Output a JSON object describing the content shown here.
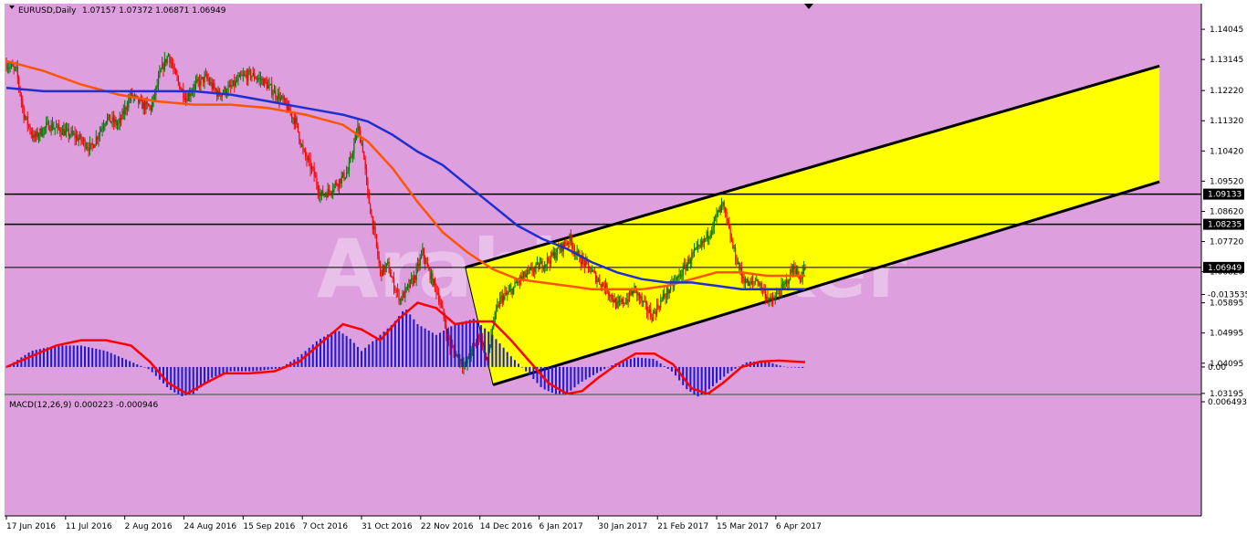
{
  "header": {
    "symbol_timeframe": "EURUSD,Daily",
    "ohlc": "1.07157 1.07372 1.06871 1.06949"
  },
  "macd_label": "MACD(12,26,9) 0.000223 -0.000946",
  "watermark": "ArabicBroker",
  "colors": {
    "background": "#dd9fdd",
    "channel_fill": "#ffff00",
    "bull_candle": "#007a00",
    "bear_candle": "#ff0000",
    "ma_fast": "#ff5500",
    "ma_slow": "#1f2fd0",
    "macd_hist": "#1a1ad8",
    "macd_signal": "#ff0000",
    "hlines": "#000000"
  },
  "chart_data": [
    {
      "type": "candlestick",
      "symbol": "EURUSD",
      "timeframe": "Daily",
      "ylim": [
        1.03,
        1.147
      ],
      "y_ticks": [
        "1.14045",
        "1.13145",
        "1.12220",
        "1.11320",
        "1.10420",
        "1.09520",
        "1.08620",
        "1.07720",
        "1.06820",
        "1.05895",
        "1.04995",
        "1.04095",
        "1.03195"
      ],
      "x_ticks": [
        "17 Jun 2016",
        "11 Jul 2016",
        "2 Aug 2016",
        "24 Aug 2016",
        "15 Sep 2016",
        "7 Oct 2016",
        "31 Oct 2016",
        "22 Nov 2016",
        "14 Dec 2016",
        "6 Jan 2017",
        "30 Jan 2017",
        "21 Feb 2017",
        "15 Mar 2017",
        "6 Apr 2017"
      ],
      "horizontal_levels": [
        {
          "label": "1.09133",
          "value": 1.09133
        },
        {
          "label": "1.08235",
          "value": 1.08235
        },
        {
          "label": "1.06949",
          "value": 1.06949
        }
      ],
      "trend_channel": {
        "upper": [
          [
            0.385,
            1.0695
          ],
          [
            0.965,
            1.1295
          ]
        ],
        "lower": [
          [
            0.4082,
            1.0345
          ],
          [
            0.965,
            1.095
          ]
        ]
      },
      "close_path": [
        [
          0,
          1.13
        ],
        [
          8,
          1.128
        ],
        [
          14,
          1.115
        ],
        [
          22,
          1.108
        ],
        [
          34,
          1.112
        ],
        [
          46,
          1.11
        ],
        [
          58,
          1.108
        ],
        [
          68,
          1.105
        ],
        [
          80,
          1.114
        ],
        [
          90,
          1.112
        ],
        [
          100,
          1.121
        ],
        [
          108,
          1.118
        ],
        [
          116,
          1.117
        ],
        [
          124,
          1.128
        ],
        [
          130,
          1.133
        ],
        [
          136,
          1.126
        ],
        [
          144,
          1.12
        ],
        [
          152,
          1.124
        ],
        [
          160,
          1.126
        ],
        [
          170,
          1.121
        ],
        [
          180,
          1.123
        ],
        [
          188,
          1.126
        ],
        [
          196,
          1.127
        ],
        [
          206,
          1.125
        ],
        [
          214,
          1.122
        ],
        [
          222,
          1.119
        ],
        [
          232,
          1.113
        ],
        [
          238,
          1.104
        ],
        [
          246,
          1.098
        ],
        [
          252,
          1.091
        ],
        [
          258,
          1.092
        ],
        [
          266,
          1.095
        ],
        [
          274,
          1.098
        ],
        [
          282,
          1.111
        ],
        [
          286,
          1.105
        ],
        [
          290,
          1.091
        ],
        [
          296,
          1.078
        ],
        [
          300,
          1.068
        ],
        [
          306,
          1.07
        ],
        [
          310,
          1.065
        ],
        [
          316,
          1.06
        ],
        [
          320,
          1.062
        ],
        [
          328,
          1.067
        ],
        [
          334,
          1.074
        ],
        [
          338,
          1.069
        ],
        [
          346,
          1.062
        ],
        [
          350,
          1.056
        ],
        [
          356,
          1.046
        ],
        [
          362,
          1.043
        ],
        [
          368,
          1.04
        ],
        [
          374,
          1.045
        ],
        [
          380,
          1.05
        ],
        [
          386,
          1.041
        ],
        [
          390,
          1.052
        ],
        [
          396,
          1.06
        ],
        [
          404,
          1.062
        ],
        [
          412,
          1.066
        ],
        [
          420,
          1.068
        ],
        [
          428,
          1.07
        ],
        [
          436,
          1.072
        ],
        [
          444,
          1.075
        ],
        [
          452,
          1.078
        ],
        [
          458,
          1.073
        ],
        [
          466,
          1.07
        ],
        [
          474,
          1.066
        ],
        [
          482,
          1.063
        ],
        [
          490,
          1.058
        ],
        [
          498,
          1.06
        ],
        [
          504,
          1.063
        ],
        [
          512,
          1.058
        ],
        [
          518,
          1.055
        ],
        [
          526,
          1.06
        ],
        [
          534,
          1.064
        ],
        [
          542,
          1.068
        ],
        [
          550,
          1.073
        ],
        [
          556,
          1.075
        ],
        [
          564,
          1.08
        ],
        [
          570,
          1.085
        ],
        [
          575,
          1.088
        ],
        [
          580,
          1.08
        ],
        [
          584,
          1.074
        ],
        [
          590,
          1.067
        ],
        [
          596,
          1.064
        ],
        [
          602,
          1.066
        ],
        [
          608,
          1.062
        ],
        [
          614,
          1.059
        ],
        [
          620,
          1.062
        ],
        [
          626,
          1.065
        ],
        [
          632,
          1.07
        ],
        [
          636,
          1.066
        ],
        [
          641,
          1.06949
        ]
      ],
      "series": [
        {
          "name": "",
          "type": "moving_average",
          "color": "#ff5500",
          "values": [
            [
              0,
              1.131
            ],
            [
              30,
              1.128
            ],
            [
              60,
              1.124
            ],
            [
              90,
              1.121
            ],
            [
              120,
              1.119
            ],
            [
              150,
              1.118
            ],
            [
              180,
              1.118
            ],
            [
              210,
              1.117
            ],
            [
              240,
              1.115
            ],
            [
              270,
              1.112
            ],
            [
              290,
              1.107
            ],
            [
              310,
              1.099
            ],
            [
              330,
              1.089
            ],
            [
              350,
              1.08
            ],
            [
              370,
              1.074
            ],
            [
              390,
              1.069
            ],
            [
              410,
              1.066
            ],
            [
              430,
              1.065
            ],
            [
              450,
              1.064
            ],
            [
              470,
              1.063
            ],
            [
              490,
              1.063
            ],
            [
              510,
              1.063
            ],
            [
              530,
              1.064
            ],
            [
              550,
              1.066
            ],
            [
              570,
              1.068
            ],
            [
              590,
              1.068
            ],
            [
              610,
              1.067
            ],
            [
              630,
              1.067
            ],
            [
              641,
              1.067
            ]
          ]
        },
        {
          "name": "",
          "type": "moving_average",
          "color": "#1f2fd0",
          "values": [
            [
              0,
              1.123
            ],
            [
              30,
              1.122
            ],
            [
              60,
              1.122
            ],
            [
              90,
              1.122
            ],
            [
              120,
              1.122
            ],
            [
              150,
              1.122
            ],
            [
              180,
              1.121
            ],
            [
              210,
              1.119
            ],
            [
              240,
              1.117
            ],
            [
              270,
              1.115
            ],
            [
              290,
              1.113
            ],
            [
              310,
              1.109
            ],
            [
              330,
              1.104
            ],
            [
              350,
              1.1
            ],
            [
              370,
              1.094
            ],
            [
              390,
              1.088
            ],
            [
              410,
              1.082
            ],
            [
              430,
              1.078
            ],
            [
              450,
              1.075
            ],
            [
              470,
              1.071
            ],
            [
              490,
              1.068
            ],
            [
              510,
              1.066
            ],
            [
              530,
              1.065
            ],
            [
              550,
              1.065
            ],
            [
              570,
              1.064
            ],
            [
              590,
              1.063
            ],
            [
              610,
              1.063
            ],
            [
              630,
              1.063
            ],
            [
              641,
              1.063
            ]
          ]
        }
      ]
    },
    {
      "type": "bar",
      "title": "MACD(12,26,9) 0.000223 -0.000946",
      "ylim": [
        -0.01353,
        0.00649
      ],
      "y_ticks": [
        "0.006493",
        "0.00",
        "-0.013535"
      ],
      "histogram_path": [
        [
          0,
          0.0
        ],
        [
          20,
          -0.003
        ],
        [
          40,
          -0.004
        ],
        [
          60,
          -0.004
        ],
        [
          80,
          -0.003
        ],
        [
          100,
          -0.001
        ],
        [
          115,
          0.0005
        ],
        [
          130,
          0.004
        ],
        [
          140,
          0.0055
        ],
        [
          150,
          0.005
        ],
        [
          165,
          0.002
        ],
        [
          180,
          0.0008
        ],
        [
          200,
          0.0008
        ],
        [
          220,
          0.0002
        ],
        [
          235,
          -0.002
        ],
        [
          250,
          -0.005
        ],
        [
          265,
          -0.007
        ],
        [
          275,
          -0.0055
        ],
        [
          285,
          -0.003
        ],
        [
          295,
          -0.005
        ],
        [
          310,
          -0.008
        ],
        [
          320,
          -0.011
        ],
        [
          330,
          -0.008
        ],
        [
          345,
          -0.006
        ],
        [
          360,
          -0.008
        ],
        [
          375,
          -0.009
        ],
        [
          390,
          -0.006
        ],
        [
          405,
          -0.002
        ],
        [
          420,
          0.0015
        ],
        [
          430,
          0.004
        ],
        [
          440,
          0.005
        ],
        [
          450,
          0.005
        ],
        [
          460,
          0.003
        ],
        [
          475,
          0.001
        ],
        [
          490,
          -0.0008
        ],
        [
          505,
          -0.0018
        ],
        [
          520,
          -0.0015
        ],
        [
          535,
          0.001
        ],
        [
          545,
          0.004
        ],
        [
          555,
          0.0055
        ],
        [
          565,
          0.004
        ],
        [
          580,
          0.001
        ],
        [
          595,
          -0.001
        ],
        [
          610,
          -0.001
        ],
        [
          625,
          0.0
        ],
        [
          641,
          0.0002
        ]
      ],
      "signal_path": [
        [
          0,
          0.0
        ],
        [
          20,
          -0.002
        ],
        [
          40,
          -0.004
        ],
        [
          60,
          -0.005
        ],
        [
          80,
          -0.005
        ],
        [
          100,
          -0.004
        ],
        [
          115,
          -0.001
        ],
        [
          130,
          0.003
        ],
        [
          145,
          0.005
        ],
        [
          160,
          0.003
        ],
        [
          175,
          0.0012
        ],
        [
          195,
          0.0012
        ],
        [
          215,
          0.0008
        ],
        [
          235,
          -0.001
        ],
        [
          255,
          -0.005
        ],
        [
          270,
          -0.008
        ],
        [
          285,
          -0.007
        ],
        [
          300,
          -0.005
        ],
        [
          315,
          -0.009
        ],
        [
          330,
          -0.012
        ],
        [
          345,
          -0.011
        ],
        [
          360,
          -0.008
        ],
        [
          375,
          -0.0085
        ],
        [
          390,
          -0.0085
        ],
        [
          405,
          -0.005
        ],
        [
          420,
          -0.001
        ],
        [
          435,
          0.003
        ],
        [
          450,
          0.005
        ],
        [
          462,
          0.0045
        ],
        [
          475,
          0.002
        ],
        [
          490,
          -0.0005
        ],
        [
          505,
          -0.0025
        ],
        [
          520,
          -0.0025
        ],
        [
          535,
          -0.0005
        ],
        [
          550,
          0.004
        ],
        [
          563,
          0.005
        ],
        [
          575,
          0.003
        ],
        [
          590,
          0.0
        ],
        [
          605,
          -0.001
        ],
        [
          620,
          -0.0012
        ],
        [
          641,
          -0.0009
        ]
      ]
    }
  ]
}
